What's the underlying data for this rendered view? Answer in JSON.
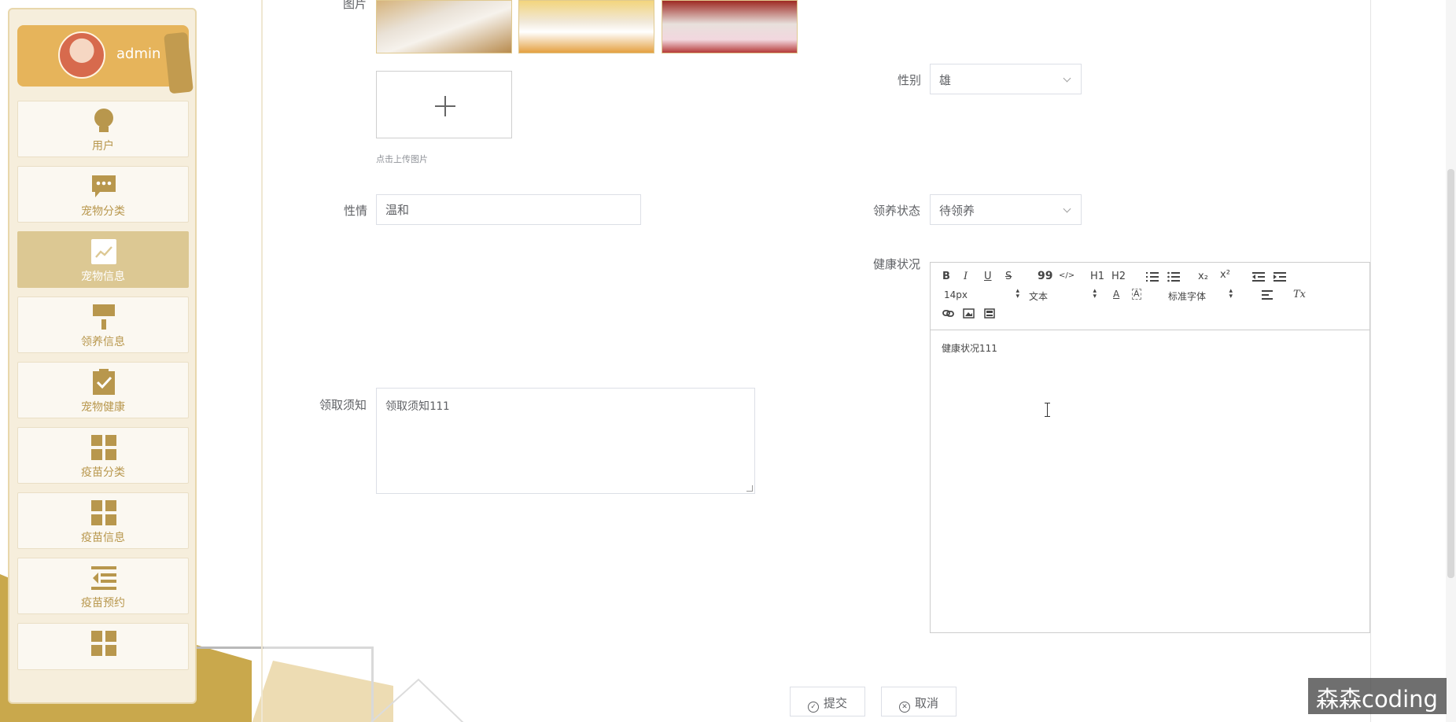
{
  "sidebar": {
    "user_name": "admin",
    "items": [
      {
        "label": "用户",
        "icon": "bulb-icon"
      },
      {
        "label": "宠物分类",
        "icon": "chat-icon"
      },
      {
        "label": "宠物信息",
        "icon": "trend-icon"
      },
      {
        "label": "领养信息",
        "icon": "brush-icon"
      },
      {
        "label": "宠物健康",
        "icon": "clipboard-check-icon"
      },
      {
        "label": "疫苗分类",
        "icon": "grid-icon"
      },
      {
        "label": "疫苗信息",
        "icon": "grid-icon"
      },
      {
        "label": "疫苗预约",
        "icon": "indent-list-icon"
      },
      {
        "label": "",
        "icon": "grid-icon"
      }
    ],
    "active_index": 2
  },
  "form": {
    "image_label": "图片",
    "upload_tip": "点击上传图片",
    "gender_label": "性别",
    "gender_value": "雄",
    "temperament_label": "性情",
    "temperament_value": "温和",
    "adopt_status_label": "领养状态",
    "adopt_status_value": "待领养",
    "health_label": "健康状况",
    "notice_label": "领取须知",
    "notice_value": "领取须知111"
  },
  "editor": {
    "toolbar": {
      "bold": "B",
      "italic": "I",
      "underline": "U",
      "strike": "S",
      "quote": "99",
      "code": "</>",
      "h1": "H1",
      "h2": "H2",
      "subscript": "x₂",
      "superscript": "x²",
      "font_size": "14px",
      "heading": "文本",
      "font_family": "标准字体",
      "clear_format": "Tx"
    },
    "content": "健康状况111"
  },
  "buttons": {
    "submit": "提交",
    "cancel": "取消"
  },
  "watermark": "森森coding",
  "colors": {
    "accent": "#c9a84c",
    "sidebar_bg": "#f6eedc",
    "active_menu": "#dcc893",
    "menu_text": "#b8974d"
  }
}
